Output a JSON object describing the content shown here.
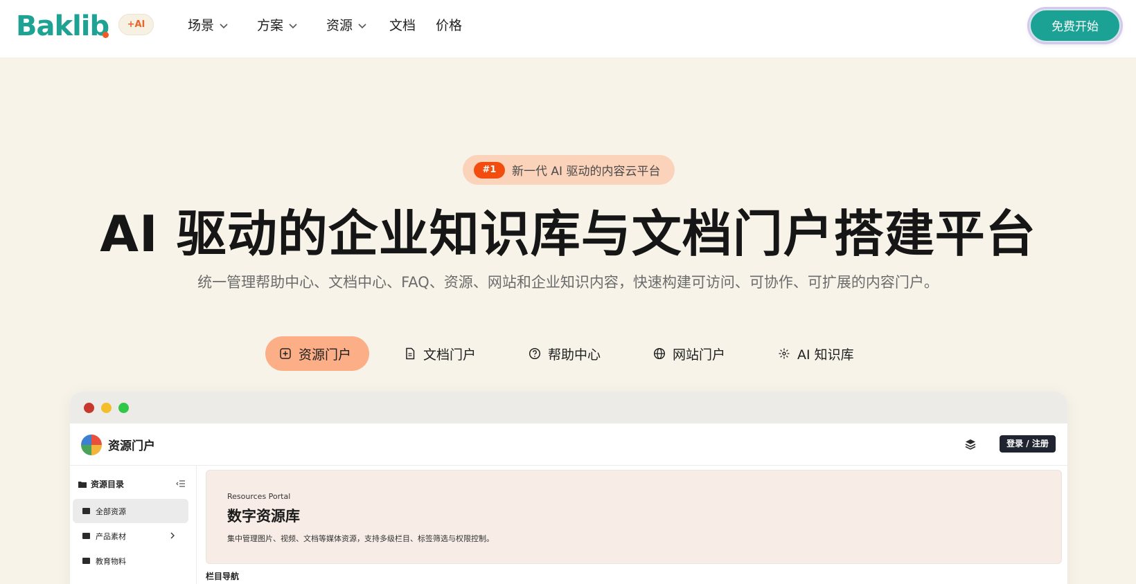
{
  "brand": {
    "logo_text": "Baklib",
    "ai_badge": "+AI",
    "logo_color": "#1ea294",
    "accent": "#f15a22"
  },
  "nav": {
    "items": [
      {
        "label": "场景",
        "has_dropdown": true
      },
      {
        "label": "方案",
        "has_dropdown": true
      },
      {
        "label": "资源",
        "has_dropdown": true
      },
      {
        "label": "文档",
        "has_dropdown": false
      },
      {
        "label": "价格",
        "has_dropdown": false
      }
    ],
    "cta_label": "免费开始"
  },
  "hero": {
    "badge_number": "#1",
    "badge_text": "新一代 AI 驱动的内容云平台",
    "title": "AI 驱动的企业知识库与文档门户搭建平台",
    "subtitle": "统一管理帮助中心、文档中心、FAQ、资源、网站和企业知识内容，快速构建可访问、可协作、可扩展的内容门户。"
  },
  "tabs": [
    {
      "label": "资源门户",
      "icon": "plus-square-icon",
      "active": true
    },
    {
      "label": "文档门户",
      "icon": "document-icon",
      "active": false
    },
    {
      "label": "帮助中心",
      "icon": "help-circle-icon",
      "active": false
    },
    {
      "label": "网站门户",
      "icon": "globe-icon",
      "active": false
    },
    {
      "label": "AI 知识库",
      "icon": "sparkle-icon",
      "active": false
    }
  ],
  "portal": {
    "title": "资源门户",
    "login_label": "登录 / 注册",
    "sidebar": {
      "heading": "资源目录",
      "items": [
        {
          "label": "全部资源",
          "active": true,
          "has_children": false
        },
        {
          "label": "产品素材",
          "active": false,
          "has_children": true
        },
        {
          "label": "教育物料",
          "active": false,
          "has_children": false
        }
      ]
    },
    "banner": {
      "eyebrow": "Resources Portal",
      "title": "数字资源库",
      "description": "集中管理图片、视频、文档等媒体资源，支持多级栏目、标签筛选与权限控制。"
    },
    "section_label": "栏目导航"
  }
}
